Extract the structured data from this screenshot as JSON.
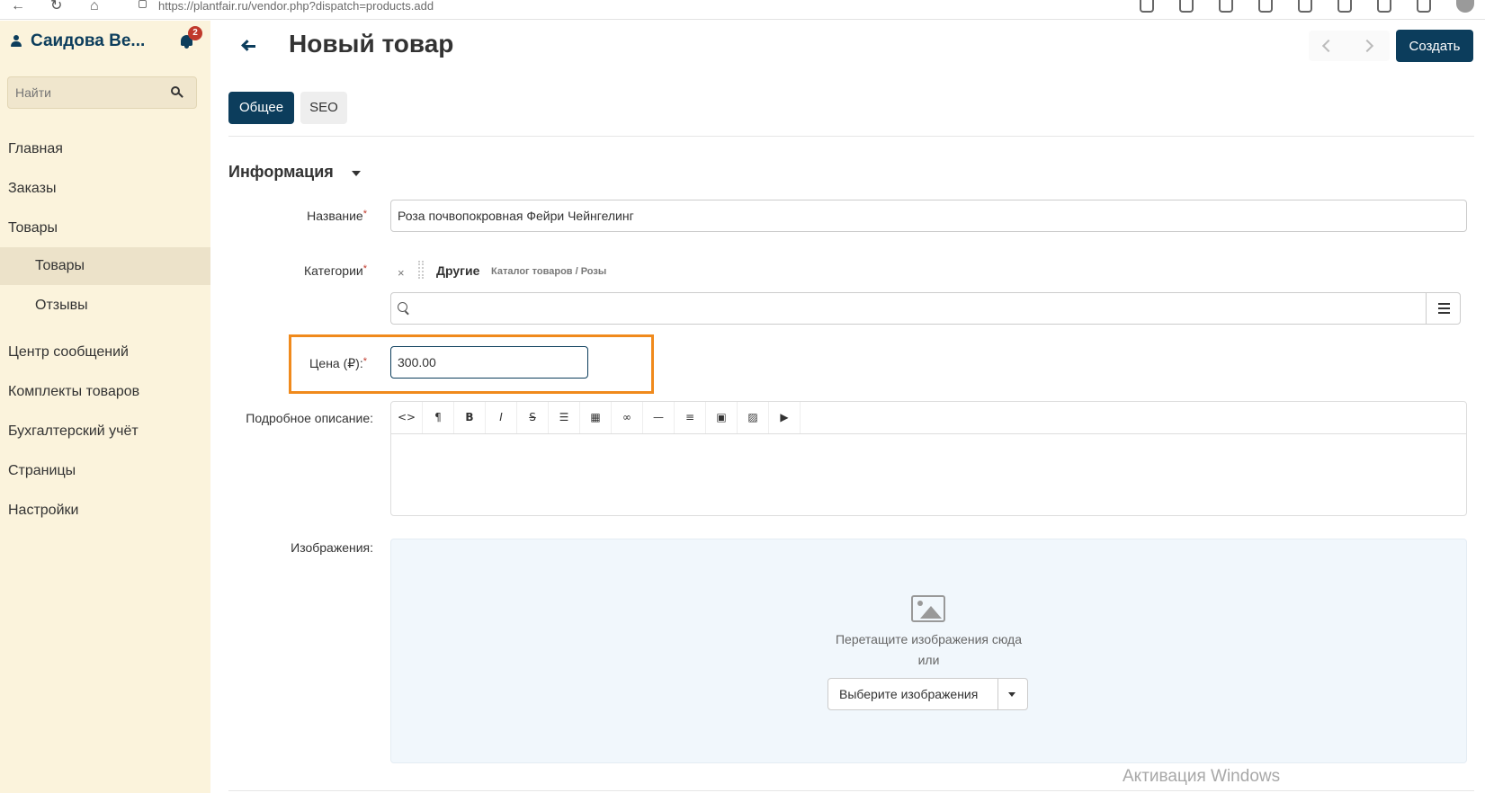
{
  "browser": {
    "url": "https://plantfair.ru/vendor.php?dispatch=products.add"
  },
  "sidebar": {
    "user_name": "Саидова Ве...",
    "notifications_count": "2",
    "search_placeholder": "Найти",
    "items": [
      {
        "label": "Главная"
      },
      {
        "label": "Заказы"
      },
      {
        "label": "Товары"
      },
      {
        "label": "Товары"
      },
      {
        "label": "Отзывы"
      },
      {
        "label": "Центр сообщений"
      },
      {
        "label": "Комплекты товаров"
      },
      {
        "label": "Бухгалтерский учёт"
      },
      {
        "label": "Страницы"
      },
      {
        "label": "Настройки"
      }
    ]
  },
  "header": {
    "title": "Новый товар",
    "create_label": "Создать"
  },
  "tabs": [
    {
      "label": "Общее"
    },
    {
      "label": "SEO"
    }
  ],
  "section": {
    "title": "Информация"
  },
  "form": {
    "name_label": "Название",
    "name_value": "Роза почвопокровная Фейри Чейнгелинг",
    "categories_label": "Категории",
    "category_remove": "×",
    "category_name": "Другие",
    "category_path": "Каталог товаров / Розы",
    "price_label": "Цена (₽):",
    "price_value": "300.00",
    "description_label": "Подробное описание:",
    "images_label": "Изображения:",
    "required_mark": "*"
  },
  "editor_toolbar": [
    "<>",
    "¶",
    "B",
    "I",
    "S",
    "list-ul",
    "table",
    "link",
    "hr",
    "align",
    "font-color",
    "image",
    "video"
  ],
  "dropzone": {
    "drag_text": "Перетащите изображения сюда",
    "or_text": "или",
    "choose_label": "Выберите изображения"
  },
  "watermark": "Активация Windows"
}
